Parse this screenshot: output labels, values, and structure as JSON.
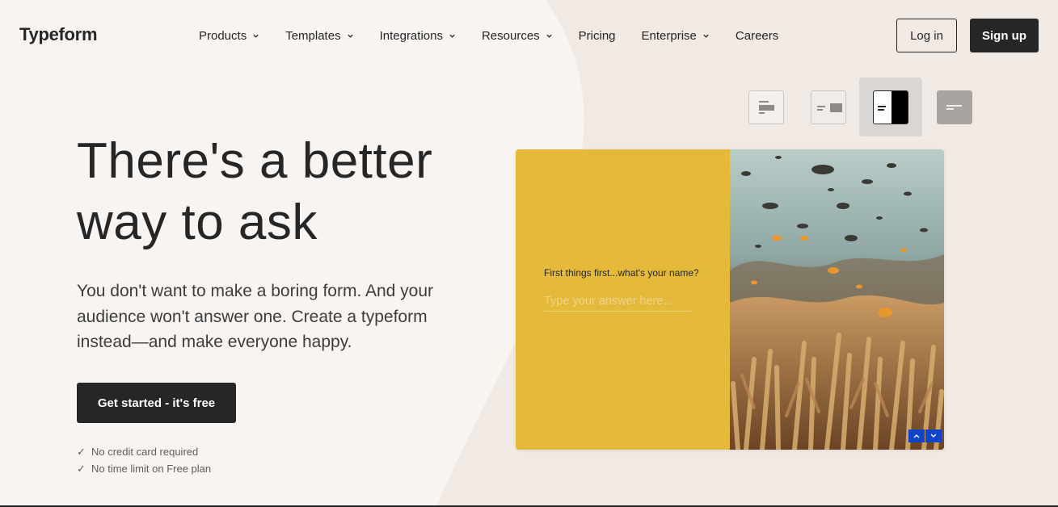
{
  "nav": {
    "logo": "Typeform",
    "menu": [
      {
        "label": "Products",
        "has_dropdown": true
      },
      {
        "label": "Templates",
        "has_dropdown": true
      },
      {
        "label": "Integrations",
        "has_dropdown": true
      },
      {
        "label": "Resources",
        "has_dropdown": true
      },
      {
        "label": "Pricing",
        "has_dropdown": false
      },
      {
        "label": "Enterprise",
        "has_dropdown": true
      },
      {
        "label": "Careers",
        "has_dropdown": false
      }
    ],
    "login_label": "Log in",
    "signup_label": "Sign up"
  },
  "hero": {
    "headline_line1": "There's a better",
    "headline_line2": "way to ask",
    "subtext": "You don't want to make a boring form. And your audience won't answer one. Create a typeform instead—and make everyone happy.",
    "cta_label": "Get started - it's free",
    "check_icon": "✓",
    "checks": [
      "No credit card required",
      "No time limit on Free plan"
    ]
  },
  "layout_switcher": {
    "icons": [
      "layout-stack-icon",
      "layout-side-icon",
      "layout-split-icon",
      "layout-wallpaper-icon"
    ],
    "selected_index": 2
  },
  "form_preview": {
    "question": "First things first...what's your name?",
    "answer_placeholder": "Type your answer here...",
    "accent_color": "#e5b93a",
    "nav_color": "#0f44c8"
  },
  "colors": {
    "background": "#f7f4f1",
    "text": "#262627",
    "button": "#262627"
  }
}
